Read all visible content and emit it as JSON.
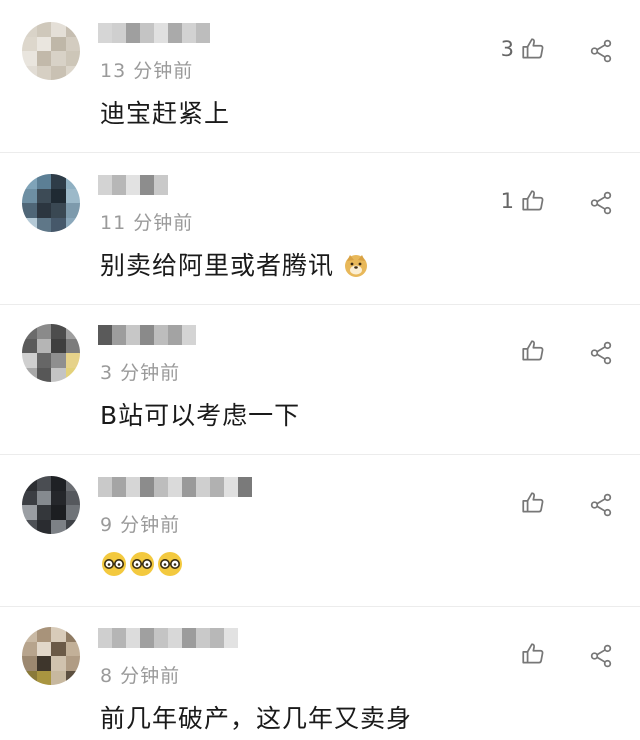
{
  "comments": [
    {
      "time": "13 分钟前",
      "text": "迪宝赶紧上",
      "likes": "3",
      "avatar_colors": [
        "#d9d3c8",
        "#cfc8bb",
        "#e4dfd7",
        "#c6beb1",
        "#ddd7cc",
        "#eae6df",
        "#bfb7a8",
        "#d3ccc0",
        "#e9e5de",
        "#c2b9aa",
        "#d8d2c7",
        "#cdc6b8",
        "#e1dcd4",
        "#d6cfc3",
        "#c9c1b3",
        "#dcd6cb"
      ],
      "name_colors": [
        "#d6d6d6",
        "#cfcfcf",
        "#9f9f9f",
        "#c4c4c4",
        "#e0e0e0",
        "#aaaaaa",
        "#d2d2d2",
        "#bdbdbd"
      ]
    },
    {
      "time": "11 分钟前",
      "text": "别卖给阿里或者腾讯",
      "emoji": "doge",
      "likes": "1",
      "avatar_colors": [
        "#7fa3b8",
        "#5c7f95",
        "#2e3c48",
        "#8fb0c2",
        "#6e8fa3",
        "#3d4b56",
        "#1f2a33",
        "#9cb9c9",
        "#4f6677",
        "#2c3640",
        "#3a4853",
        "#7d9aac",
        "#b4c9d6",
        "#5f7788",
        "#46586a",
        "#8aa7ba"
      ],
      "name_colors": [
        "#d3d3d3",
        "#b7b7b7",
        "#e2e2e2",
        "#8d8d8d",
        "#c9c9c9"
      ]
    },
    {
      "time": "3 分钟前",
      "text": "B站可以考虑一下",
      "likes": "",
      "avatar_colors": [
        "#6b6b6b",
        "#8a8a8a",
        "#4d4d4d",
        "#9e9e9e",
        "#5a5a5a",
        "#b5b5b5",
        "#3f3f3f",
        "#7c7c7c",
        "#cfcfcf",
        "#666666",
        "#8f8f8f",
        "#e6d28a",
        "#a8a8a8",
        "#575757",
        "#c4c4c4",
        "#e3d17a"
      ],
      "name_colors": [
        "#5a5a5a",
        "#9d9d9d",
        "#c7c7c7",
        "#8a8a8a",
        "#bdbdbd",
        "#a3a3a3",
        "#d4d4d4"
      ]
    },
    {
      "time": "9 分钟前",
      "text": "",
      "emoji_glasses": 3,
      "likes": "",
      "avatar_colors": [
        "#2d2f33",
        "#4a4d52",
        "#1f2125",
        "#6a6d72",
        "#3b3e43",
        "#858a8f",
        "#25272b",
        "#55585d",
        "#9a9ea3",
        "#34373b",
        "#1c1e21",
        "#6f7378",
        "#4e5156",
        "#2a2c30",
        "#7d8186",
        "#3f4247"
      ],
      "name_colors": [
        "#c9c9c9",
        "#a5a5a5",
        "#d6d6d6",
        "#8c8c8c",
        "#bdbdbd",
        "#dadada",
        "#9a9a9a",
        "#cfcfcf",
        "#b1b1b1",
        "#e0e0e0",
        "#7a7a7a"
      ]
    },
    {
      "time": "8 分钟前",
      "text": "前几年破产，这几年又卖身",
      "likes": "",
      "avatar_colors": [
        "#c9b9a4",
        "#a8937a",
        "#d8cbb9",
        "#8f7b63",
        "#b7a48d",
        "#e1d7c9",
        "#6b5a47",
        "#c2b098",
        "#9c8870",
        "#3e362c",
        "#d0c2ae",
        "#b09c84",
        "#8a7a3a",
        "#a99540",
        "#c7b89f",
        "#5c4f3f"
      ],
      "name_colors": [
        "#cfcfcf",
        "#b5b5b5",
        "#dcdcdc",
        "#a0a0a0",
        "#c4c4c4",
        "#d8d8d8",
        "#9c9c9c",
        "#c9c9c9",
        "#b8b8b8",
        "#e2e2e2"
      ]
    }
  ],
  "colors": {
    "time": "#9a9a9a",
    "text": "#1a1a1a",
    "icon": "#777777"
  },
  "icons": {
    "like": "thumbs-up-outline-icon",
    "share": "share-nodes-icon",
    "doge": "doge-emoji-icon",
    "glasses": "glasses-emoji-icon"
  }
}
